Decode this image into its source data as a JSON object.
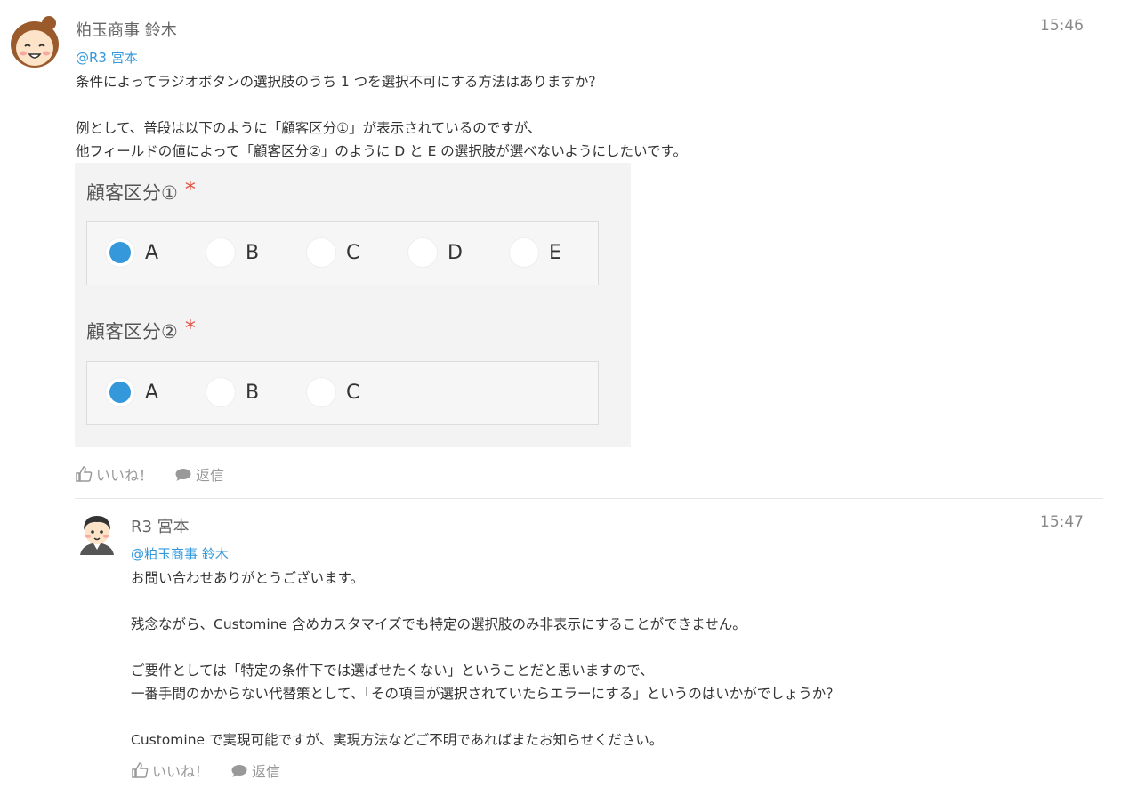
{
  "post1": {
    "author": "粕玉商事 鈴木",
    "time": "15:46",
    "mention": "@R3 宮本",
    "lines": [
      "条件によってラジオボタンの選択肢のうち 1 つを選択不可にする方法はありますか？",
      "例として、普段は以下のように「顧客区分①」が表示されているのですが、",
      "他フィールドの値によって「顧客区分②」のように D と E の選択肢が選べないようにしたいです。"
    ],
    "figure": {
      "field1": {
        "label": "顧客区分①",
        "required_mark": "*",
        "options": [
          "A",
          "B",
          "C",
          "D",
          "E"
        ],
        "selected": "A"
      },
      "field2": {
        "label": "顧客区分②",
        "required_mark": "*",
        "options": [
          "A",
          "B",
          "C"
        ],
        "selected": "A"
      }
    },
    "like_label": "いいね！",
    "reply_label": "返信"
  },
  "post2": {
    "author": "R3 宮本",
    "time": "15:47",
    "mention": "@粕玉商事 鈴木",
    "lines": [
      "お問い合わせありがとうございます。",
      "残念ながら、Customine 含めカスタマイズでも特定の選択肢のみ非表示にすることができません。",
      "ご要件としては「特定の条件下では選ばせたくない」ということだと思いますので、",
      "一番手間のかからない代替策として、「その項目が選択されていたらエラーにする」というのはいかがでしょうか？",
      "Customine で実現可能ですが、実現方法などご不明であればまたお知らせください。"
    ],
    "like_label": "いいね！",
    "reply_label": "返信"
  },
  "colors": {
    "accent": "#3498db",
    "required": "#e74c3c",
    "muted": "#999999"
  },
  "icons": {
    "like": "thumbs-up-icon",
    "reply": "speech-bubble-icon"
  }
}
